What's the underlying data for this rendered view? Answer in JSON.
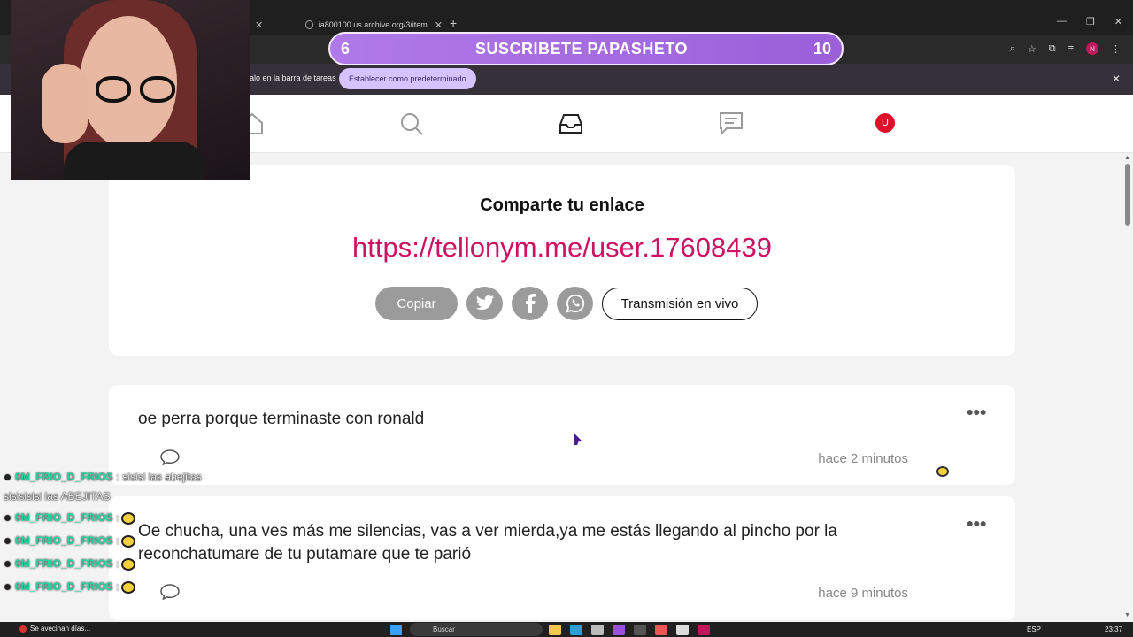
{
  "browser": {
    "tabs": [
      {
        "title": ""
      },
      {
        "title": "ia800100.us.archive.org/3/item"
      }
    ],
    "infobar": {
      "text": "alo en la barra de tareas",
      "button": "Establecer como predeterminado"
    },
    "profile_initial": "N"
  },
  "overlay_banner": {
    "left_number": "6",
    "title": "SUSCRIBETE PAPASHETO",
    "right_number": "10"
  },
  "app_nav": {
    "items": [
      "home-icon",
      "search-icon",
      "inbox-icon",
      "chat-icon"
    ],
    "user_initial": "U",
    "user_color": "#e0102a"
  },
  "share_card": {
    "title": "Comparte tu enlace",
    "link": "https://tellonym.me/user.17608439",
    "link_color": "#cc1261",
    "copy_label": "Copiar",
    "social_icons": [
      "twitter-icon",
      "facebook-icon",
      "whatsapp-icon"
    ],
    "live_label": "Transmisión en vivo"
  },
  "messages": [
    {
      "text": "oe perra porque terminaste con ronald",
      "time": "hace 2 minutos"
    },
    {
      "text": "Oe chucha, una ves más me silencias, vas a ver mierda,ya me estás llegando al pincho por la reconchatumare de tu putamare que te parió",
      "time": "hace 9 minutos"
    }
  ],
  "stream_chat": [
    {
      "user": "0M_FRIO_D_FRIOS",
      "sep": ":",
      "message": "sisisi las abejitas"
    },
    {
      "user": "",
      "sep": "",
      "message": "sisisisisi las ABEJITAS"
    },
    {
      "user": "0M_FRIO_D_FRIOS",
      "sep": ":",
      "message": ""
    },
    {
      "user": "0M_FRIO_D_FRIOS",
      "sep": ":",
      "message": ""
    },
    {
      "user": "0M_FRIO_D_FRIOS",
      "sep": ":",
      "message": ""
    },
    {
      "user": "0M_FRIO_D_FRIOS",
      "sep": ":",
      "message": ""
    }
  ],
  "taskbar": {
    "notification": "Se avecinan días...",
    "search_placeholder": "Buscar",
    "language": "ESP",
    "clock": "23:37"
  }
}
